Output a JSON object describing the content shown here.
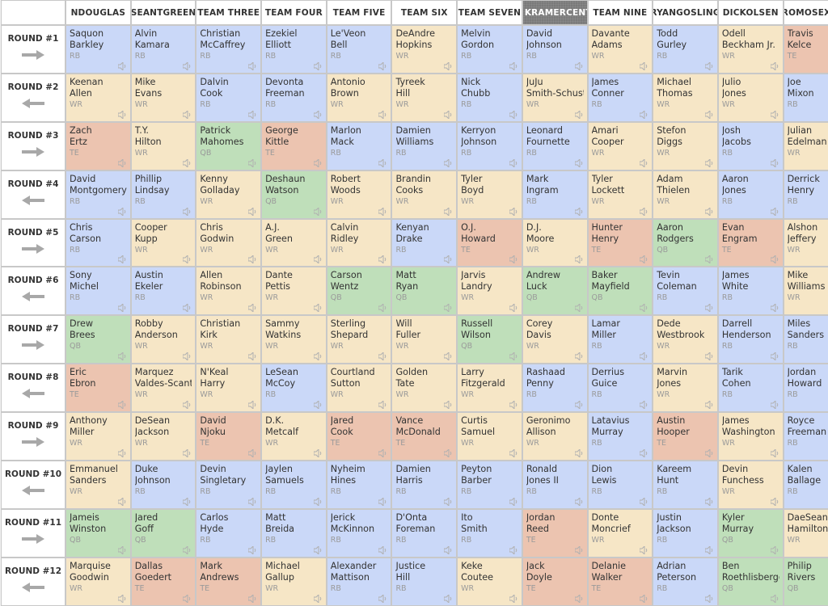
{
  "teams": [
    "NDOUGLAS",
    "SEANTGREEN",
    "TEAM THREE",
    "TEAM FOUR",
    "TEAM FIVE",
    "TEAM SIX",
    "TEAM SEVEN",
    "KRAMERCENTR",
    "TEAM NINE",
    "RYANGOSLING",
    "DICKOLSEN",
    "ROMOSEXUAL"
  ],
  "active_team_index": 7,
  "position_colors": {
    "RB": "#cad8f8",
    "WR": "#f6e6c6",
    "TE": "#ecc4b0",
    "QB": "#bfdfba"
  },
  "rounds": [
    {
      "label": "ROUND #1",
      "direction": "right",
      "picks": [
        {
          "first": "Saquon",
          "last": "Barkley",
          "pos": "RB"
        },
        {
          "first": "Alvin",
          "last": "Kamara",
          "pos": "RB"
        },
        {
          "first": "Christian",
          "last": "McCaffrey",
          "pos": "RB"
        },
        {
          "first": "Ezekiel",
          "last": "Elliott",
          "pos": "RB"
        },
        {
          "first": "Le'Veon",
          "last": "Bell",
          "pos": "RB"
        },
        {
          "first": "DeAndre",
          "last": "Hopkins",
          "pos": "WR"
        },
        {
          "first": "Melvin",
          "last": "Gordon",
          "pos": "RB"
        },
        {
          "first": "David",
          "last": "Johnson",
          "pos": "RB"
        },
        {
          "first": "Davante",
          "last": "Adams",
          "pos": "WR"
        },
        {
          "first": "Todd",
          "last": "Gurley",
          "pos": "RB"
        },
        {
          "first": "Odell",
          "last": "Beckham Jr.",
          "pos": "WR"
        },
        {
          "first": "Travis",
          "last": "Kelce",
          "pos": "TE"
        }
      ]
    },
    {
      "label": "ROUND #2",
      "direction": "left",
      "picks": [
        {
          "first": "Keenan",
          "last": "Allen",
          "pos": "WR"
        },
        {
          "first": "Mike",
          "last": "Evans",
          "pos": "WR"
        },
        {
          "first": "Dalvin",
          "last": "Cook",
          "pos": "RB"
        },
        {
          "first": "Devonta",
          "last": "Freeman",
          "pos": "RB"
        },
        {
          "first": "Antonio",
          "last": "Brown",
          "pos": "WR"
        },
        {
          "first": "Tyreek",
          "last": "Hill",
          "pos": "WR"
        },
        {
          "first": "Nick",
          "last": "Chubb",
          "pos": "RB"
        },
        {
          "first": "JuJu",
          "last": "Smith-Schuster",
          "pos": "WR"
        },
        {
          "first": "James",
          "last": "Conner",
          "pos": "RB"
        },
        {
          "first": "Michael",
          "last": "Thomas",
          "pos": "WR"
        },
        {
          "first": "Julio",
          "last": "Jones",
          "pos": "WR"
        },
        {
          "first": "Joe",
          "last": "Mixon",
          "pos": "RB"
        }
      ]
    },
    {
      "label": "ROUND #3",
      "direction": "right",
      "picks": [
        {
          "first": "Zach",
          "last": "Ertz",
          "pos": "TE"
        },
        {
          "first": "T.Y.",
          "last": "Hilton",
          "pos": "WR"
        },
        {
          "first": "Patrick",
          "last": "Mahomes",
          "pos": "QB"
        },
        {
          "first": "George",
          "last": "Kittle",
          "pos": "TE"
        },
        {
          "first": "Marlon",
          "last": "Mack",
          "pos": "RB"
        },
        {
          "first": "Damien",
          "last": "Williams",
          "pos": "RB"
        },
        {
          "first": "Kerryon",
          "last": "Johnson",
          "pos": "RB"
        },
        {
          "first": "Leonard",
          "last": "Fournette",
          "pos": "RB"
        },
        {
          "first": "Amari",
          "last": "Cooper",
          "pos": "WR"
        },
        {
          "first": "Stefon",
          "last": "Diggs",
          "pos": "WR"
        },
        {
          "first": "Josh",
          "last": "Jacobs",
          "pos": "RB"
        },
        {
          "first": "Julian",
          "last": "Edelman",
          "pos": "WR"
        }
      ]
    },
    {
      "label": "ROUND #4",
      "direction": "left",
      "picks": [
        {
          "first": "David",
          "last": "Montgomery",
          "pos": "RB"
        },
        {
          "first": "Phillip",
          "last": "Lindsay",
          "pos": "RB"
        },
        {
          "first": "Kenny",
          "last": "Golladay",
          "pos": "WR"
        },
        {
          "first": "Deshaun",
          "last": "Watson",
          "pos": "QB"
        },
        {
          "first": "Robert",
          "last": "Woods",
          "pos": "WR"
        },
        {
          "first": "Brandin",
          "last": "Cooks",
          "pos": "WR"
        },
        {
          "first": "Tyler",
          "last": "Boyd",
          "pos": "WR"
        },
        {
          "first": "Mark",
          "last": "Ingram",
          "pos": "RB"
        },
        {
          "first": "Tyler",
          "last": "Lockett",
          "pos": "WR"
        },
        {
          "first": "Adam",
          "last": "Thielen",
          "pos": "WR"
        },
        {
          "first": "Aaron",
          "last": "Jones",
          "pos": "RB"
        },
        {
          "first": "Derrick",
          "last": "Henry",
          "pos": "RB"
        }
      ]
    },
    {
      "label": "ROUND #5",
      "direction": "right",
      "picks": [
        {
          "first": "Chris",
          "last": "Carson",
          "pos": "RB"
        },
        {
          "first": "Cooper",
          "last": "Kupp",
          "pos": "WR"
        },
        {
          "first": "Chris",
          "last": "Godwin",
          "pos": "WR"
        },
        {
          "first": "A.J.",
          "last": "Green",
          "pos": "WR"
        },
        {
          "first": "Calvin",
          "last": "Ridley",
          "pos": "WR"
        },
        {
          "first": "Kenyan",
          "last": "Drake",
          "pos": "RB"
        },
        {
          "first": "O.J.",
          "last": "Howard",
          "pos": "TE"
        },
        {
          "first": "D.J.",
          "last": "Moore",
          "pos": "WR"
        },
        {
          "first": "Hunter",
          "last": "Henry",
          "pos": "TE"
        },
        {
          "first": "Aaron",
          "last": "Rodgers",
          "pos": "QB"
        },
        {
          "first": "Evan",
          "last": "Engram",
          "pos": "TE"
        },
        {
          "first": "Alshon",
          "last": "Jeffery",
          "pos": "WR"
        }
      ]
    },
    {
      "label": "ROUND #6",
      "direction": "left",
      "picks": [
        {
          "first": "Sony",
          "last": "Michel",
          "pos": "RB"
        },
        {
          "first": "Austin",
          "last": "Ekeler",
          "pos": "RB"
        },
        {
          "first": "Allen",
          "last": "Robinson",
          "pos": "WR"
        },
        {
          "first": "Dante",
          "last": "Pettis",
          "pos": "WR"
        },
        {
          "first": "Carson",
          "last": "Wentz",
          "pos": "QB"
        },
        {
          "first": "Matt",
          "last": "Ryan",
          "pos": "QB"
        },
        {
          "first": "Jarvis",
          "last": "Landry",
          "pos": "WR"
        },
        {
          "first": "Andrew",
          "last": "Luck",
          "pos": "QB"
        },
        {
          "first": "Baker",
          "last": "Mayfield",
          "pos": "QB"
        },
        {
          "first": "Tevin",
          "last": "Coleman",
          "pos": "RB"
        },
        {
          "first": "James",
          "last": "White",
          "pos": "RB"
        },
        {
          "first": "Mike",
          "last": "Williams",
          "pos": "WR"
        }
      ]
    },
    {
      "label": "ROUND #7",
      "direction": "right",
      "picks": [
        {
          "first": "Drew",
          "last": "Brees",
          "pos": "QB"
        },
        {
          "first": "Robby",
          "last": "Anderson",
          "pos": "WR"
        },
        {
          "first": "Christian",
          "last": "Kirk",
          "pos": "WR"
        },
        {
          "first": "Sammy",
          "last": "Watkins",
          "pos": "WR"
        },
        {
          "first": "Sterling",
          "last": "Shepard",
          "pos": "WR"
        },
        {
          "first": "Will",
          "last": "Fuller",
          "pos": "WR"
        },
        {
          "first": "Russell",
          "last": "Wilson",
          "pos": "QB"
        },
        {
          "first": "Corey",
          "last": "Davis",
          "pos": "WR"
        },
        {
          "first": "Lamar",
          "last": "Miller",
          "pos": "RB"
        },
        {
          "first": "Dede",
          "last": "Westbrook",
          "pos": "WR"
        },
        {
          "first": "Darrell",
          "last": "Henderson",
          "pos": "RB"
        },
        {
          "first": "Miles",
          "last": "Sanders",
          "pos": "RB"
        }
      ]
    },
    {
      "label": "ROUND #8",
      "direction": "left",
      "picks": [
        {
          "first": "Eric",
          "last": "Ebron",
          "pos": "TE"
        },
        {
          "first": "Marquez",
          "last": "Valdes-Scantling",
          "pos": "WR"
        },
        {
          "first": "N'Keal",
          "last": "Harry",
          "pos": "WR"
        },
        {
          "first": "LeSean",
          "last": "McCoy",
          "pos": "RB"
        },
        {
          "first": "Courtland",
          "last": "Sutton",
          "pos": "WR"
        },
        {
          "first": "Golden",
          "last": "Tate",
          "pos": "WR"
        },
        {
          "first": "Larry",
          "last": "Fitzgerald",
          "pos": "WR"
        },
        {
          "first": "Rashaad",
          "last": "Penny",
          "pos": "RB"
        },
        {
          "first": "Derrius",
          "last": "Guice",
          "pos": "RB"
        },
        {
          "first": "Marvin",
          "last": "Jones",
          "pos": "WR"
        },
        {
          "first": "Tarik",
          "last": "Cohen",
          "pos": "RB"
        },
        {
          "first": "Jordan",
          "last": "Howard",
          "pos": "RB"
        }
      ]
    },
    {
      "label": "ROUND #9",
      "direction": "right",
      "picks": [
        {
          "first": "Anthony",
          "last": "Miller",
          "pos": "WR"
        },
        {
          "first": "DeSean",
          "last": "Jackson",
          "pos": "WR"
        },
        {
          "first": "David",
          "last": "Njoku",
          "pos": "TE"
        },
        {
          "first": "D.K.",
          "last": "Metcalf",
          "pos": "WR"
        },
        {
          "first": "Jared",
          "last": "Cook",
          "pos": "TE"
        },
        {
          "first": "Vance",
          "last": "McDonald",
          "pos": "TE"
        },
        {
          "first": "Curtis",
          "last": "Samuel",
          "pos": "WR"
        },
        {
          "first": "Geronimo",
          "last": "Allison",
          "pos": "WR"
        },
        {
          "first": "Latavius",
          "last": "Murray",
          "pos": "RB"
        },
        {
          "first": "Austin",
          "last": "Hooper",
          "pos": "TE"
        },
        {
          "first": "James",
          "last": "Washington",
          "pos": "WR"
        },
        {
          "first": "Royce",
          "last": "Freeman",
          "pos": "RB"
        }
      ]
    },
    {
      "label": "ROUND #10",
      "direction": "left",
      "picks": [
        {
          "first": "Emmanuel",
          "last": "Sanders",
          "pos": "WR"
        },
        {
          "first": "Duke",
          "last": "Johnson",
          "pos": "RB"
        },
        {
          "first": "Devin",
          "last": "Singletary",
          "pos": "RB"
        },
        {
          "first": "Jaylen",
          "last": "Samuels",
          "pos": "RB"
        },
        {
          "first": "Nyheim",
          "last": "Hines",
          "pos": "RB"
        },
        {
          "first": "Damien",
          "last": "Harris",
          "pos": "RB"
        },
        {
          "first": "Peyton",
          "last": "Barber",
          "pos": "RB"
        },
        {
          "first": "Ronald",
          "last": "Jones II",
          "pos": "RB"
        },
        {
          "first": "Dion",
          "last": "Lewis",
          "pos": "RB"
        },
        {
          "first": "Kareem",
          "last": "Hunt",
          "pos": "RB"
        },
        {
          "first": "Devin",
          "last": "Funchess",
          "pos": "WR"
        },
        {
          "first": "Kalen",
          "last": "Ballage",
          "pos": "RB"
        }
      ]
    },
    {
      "label": "ROUND #11",
      "direction": "right",
      "picks": [
        {
          "first": "Jameis",
          "last": "Winston",
          "pos": "QB"
        },
        {
          "first": "Jared",
          "last": "Goff",
          "pos": "QB"
        },
        {
          "first": "Carlos",
          "last": "Hyde",
          "pos": "RB"
        },
        {
          "first": "Matt",
          "last": "Breida",
          "pos": "RB"
        },
        {
          "first": "Jerick",
          "last": "McKinnon",
          "pos": "RB"
        },
        {
          "first": "D'Onta",
          "last": "Foreman",
          "pos": "RB"
        },
        {
          "first": "Ito",
          "last": "Smith",
          "pos": "RB"
        },
        {
          "first": "Jordan",
          "last": "Reed",
          "pos": "TE"
        },
        {
          "first": "Donte",
          "last": "Moncrief",
          "pos": "WR"
        },
        {
          "first": "Justin",
          "last": "Jackson",
          "pos": "RB"
        },
        {
          "first": "Kyler",
          "last": "Murray",
          "pos": "QB"
        },
        {
          "first": "DaeSean",
          "last": "Hamilton",
          "pos": "WR"
        }
      ]
    },
    {
      "label": "ROUND #12",
      "direction": "left",
      "picks": [
        {
          "first": "Marquise",
          "last": "Goodwin",
          "pos": "WR"
        },
        {
          "first": "Dallas",
          "last": "Goedert",
          "pos": "TE"
        },
        {
          "first": "Mark",
          "last": "Andrews",
          "pos": "TE"
        },
        {
          "first": "Michael",
          "last": "Gallup",
          "pos": "WR"
        },
        {
          "first": "Alexander",
          "last": "Mattison",
          "pos": "RB"
        },
        {
          "first": "Justice",
          "last": "Hill",
          "pos": "RB"
        },
        {
          "first": "Keke",
          "last": "Coutee",
          "pos": "WR"
        },
        {
          "first": "Jack",
          "last": "Doyle",
          "pos": "TE"
        },
        {
          "first": "Delanie",
          "last": "Walker",
          "pos": "TE"
        },
        {
          "first": "Adrian",
          "last": "Peterson",
          "pos": "RB"
        },
        {
          "first": "Ben",
          "last": "Roethlisberger",
          "pos": "QB"
        },
        {
          "first": "Philip",
          "last": "Rivers",
          "pos": "QB"
        }
      ]
    }
  ]
}
